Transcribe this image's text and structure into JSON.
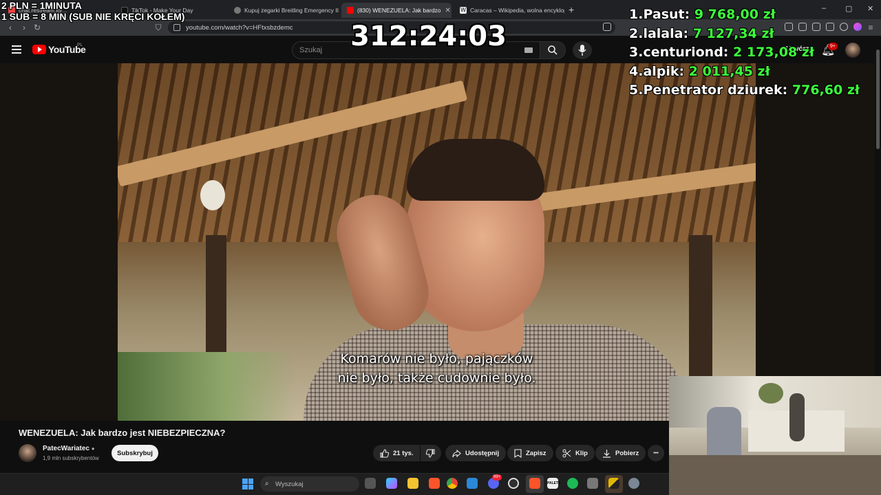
{
  "browser": {
    "tabs": [
      {
        "label": "chat.restream.io/...",
        "active": false,
        "color": "#e44"
      },
      {
        "label": "TikTok - Make Your Day",
        "active": false,
        "color": "#111"
      },
      {
        "label": "Kupuj zegarki Breitling Emergency II",
        "active": false,
        "color": "#777"
      },
      {
        "label": "(830) WENEZUELA: Jak bardzo",
        "active": true,
        "color": "#f00"
      },
      {
        "label": "Caracas – Wikipedia, wolna encyklop",
        "active": false,
        "color": "#eee"
      }
    ],
    "new_tab": "+",
    "url": "youtube.com/watch?v=HFtxsbzdemc",
    "window_controls": {
      "minimize": "–",
      "maximize": "▢",
      "close": "✕"
    }
  },
  "youtube": {
    "logo_text": "YouTube",
    "logo_region": "PL",
    "search_placeholder": "Szukaj",
    "notifications_badge": "9+",
    "create_label": "Utwórz",
    "video": {
      "subtitle_line1": "Komarów nie było, pajączków",
      "subtitle_line2": "nie było, także cudownie było.",
      "title": "WENEZUELA: Jak bardzo jest NIEBEZPIECZNA?"
    },
    "channel": {
      "name": "PatecWariatec",
      "subscribers": "1,9 mln subskrybentów",
      "subscribe_label": "Subskrybuj"
    },
    "actions": {
      "likes": "21 tys.",
      "share": "Udostępnij",
      "save": "Zapisz",
      "clip": "Klip",
      "download": "Pobierz",
      "more": "•••"
    }
  },
  "stream_overlay": {
    "rule1": "2 PLN =  1MINUTA",
    "rule2": "1 SUB = 8 MIN (SUB NIE KRĘCI KOŁEM)",
    "timer": "312:24:03",
    "leaderboard": [
      {
        "rank": "1.",
        "name": "Pasut:",
        "amount": "9 768,00 zł"
      },
      {
        "rank": "2.",
        "name": "lalala:",
        "amount": "7 127,34 zł"
      },
      {
        "rank": "3.",
        "name": "centuriond:",
        "amount": "2 173,08 zł"
      },
      {
        "rank": "4.",
        "name": "alpik:",
        "amount": "2 011,45 zł"
      },
      {
        "rank": "5.",
        "name": "Penetrator dziurek:",
        "amount": "776,60 zł"
      }
    ]
  },
  "taskbar": {
    "search_placeholder": "Wyszukaj",
    "badge_a": "99+",
    "app_icons": [
      "windows-start-icon",
      "task-view-icon",
      "copilot-icon",
      "file-explorer-icon",
      "brave-browser-icon",
      "chrome-icon",
      "store-icon",
      "discord-icon",
      "obs-icon",
      "brave-icon",
      "paint-icon",
      "spotify-icon",
      "calculator-icon",
      "stream-app-icon",
      "settings-icon"
    ]
  }
}
